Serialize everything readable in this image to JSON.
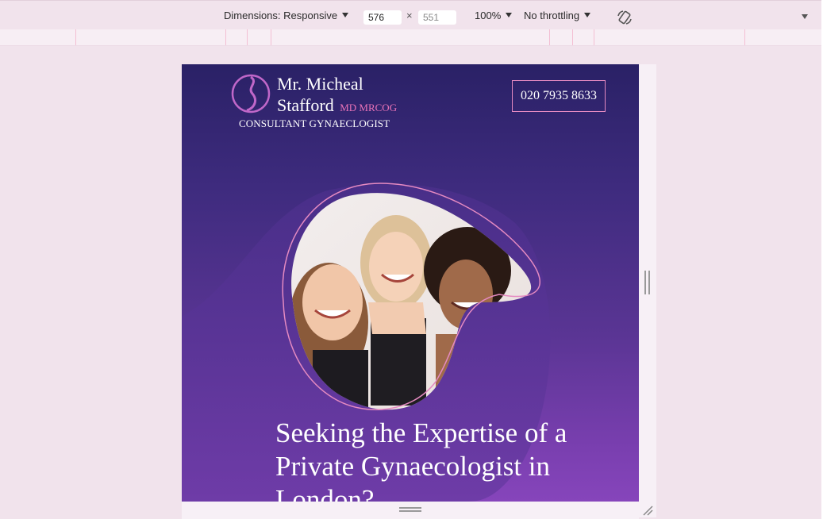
{
  "devtools": {
    "dimensions_label": "Dimensions: Responsive",
    "width_value": "576",
    "times": "×",
    "height_value": "551",
    "zoom_label": "100%",
    "throttling_label": "No throttling"
  },
  "site": {
    "brand_line1": "Mr. Micheal",
    "brand_line2": "Stafford",
    "brand_suffix": "MD MRCOG",
    "tagline": "CONSULTANT GYNAECLOGIST",
    "phone": "020 7935 8633",
    "headline": "Seeking the Expertise of a Private Gynaecologist in London?",
    "hero_image_alt": "three smiling women"
  },
  "colors": {
    "accent_pink": "#ea73b8",
    "gradient_top": "#2a2166",
    "gradient_bottom": "#8645bb"
  }
}
